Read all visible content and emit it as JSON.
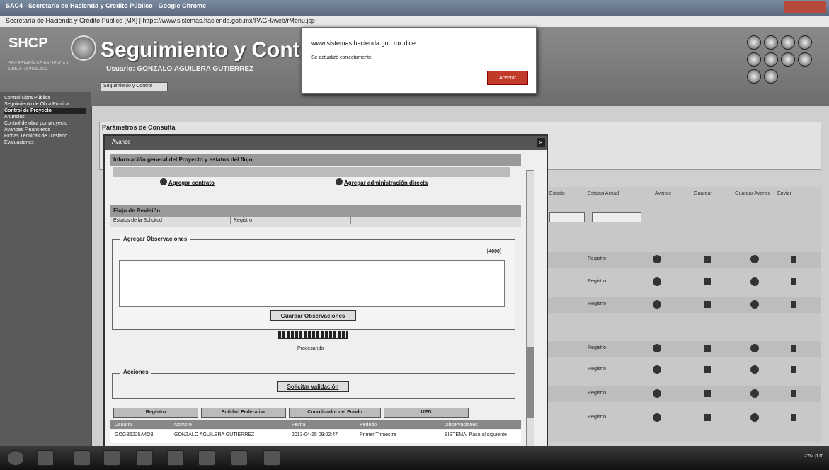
{
  "browser": {
    "window_title": "SAC4 - Secretaría de Hacienda y Crédito Público - Google Chrome",
    "address": "Secretaría de Hacienda y Crédito Público [MX] | https://www.sistemas.hacienda.gob.mx/PAGH/web/rMenu.jsp"
  },
  "app": {
    "logo": "SHCP",
    "logo_sub": "SECRETARÍA DE HACIENDA Y CRÉDITO PÚBLICO",
    "title": "Seguimiento y Control",
    "user": "Usuario: GONZALO AGUILERA GUTIERREZ",
    "toolbar": "Seguimiento y Control"
  },
  "sidebar": {
    "items": [
      {
        "label": "Control Obra Pública"
      },
      {
        "label": "Seguimiento de Obra Pública"
      },
      {
        "label": "Control de Proyecto"
      },
      {
        "label": "Anuncios"
      },
      {
        "label": "Control de obra por proyecto"
      },
      {
        "label": "Avances Financieros"
      },
      {
        "label": "Fichas Técnicas de Traslado"
      },
      {
        "label": "Evaluaciones"
      }
    ]
  },
  "params": {
    "title": "Parámetros de Consulta"
  },
  "grid": {
    "headers": [
      "Estado",
      "Estatus Actual",
      "Avance",
      "Guardar",
      "Guardar Avance",
      "Enviar"
    ],
    "rows": [
      {
        "status": "Registro"
      },
      {
        "status": "Registro"
      },
      {
        "status": "Registro"
      },
      {
        "status": "Registro"
      },
      {
        "status": "Registro"
      },
      {
        "status": "Registro"
      },
      {
        "status": "Registro"
      }
    ]
  },
  "modal": {
    "title": "Avance",
    "section1": "Información general del Proyecto y estatus del flujo",
    "add_contract": "Agregar contrato",
    "add_direct": "Agregar administración directa",
    "section2": "Flujo de Revisión",
    "subtab1": "Estatus de la Solicitud",
    "subtab2": "Registro",
    "obs_label": "Agregar Observaciones",
    "counter": "[4000]",
    "save_obs": "Guardar Observaciones",
    "processing": "Procesando",
    "actions_label": "Acciones",
    "validate": "Solicitar validación",
    "bottom_tabs": [
      "Registro",
      "Entidad Federativa",
      "Coordinador del Fondo",
      "UPD"
    ],
    "table_headers": [
      "Usuario",
      "Nombre",
      "Fecha",
      "Periodo",
      "Observaciones"
    ],
    "table_row": [
      "GOGB6225A4Q3",
      "GONZALO AGUILERA GUTIERREZ",
      "2013-04-15 09:02:47",
      "Primer Trimestre",
      "SISTEMA: Pasó al siguiente"
    ]
  },
  "dialog": {
    "title": "www.sistemas.hacienda.gob.mx dice",
    "message": "Se actualizó correctamente.",
    "ok": "Aceptar"
  },
  "taskbar": {
    "clock": "2:52 p.m."
  }
}
